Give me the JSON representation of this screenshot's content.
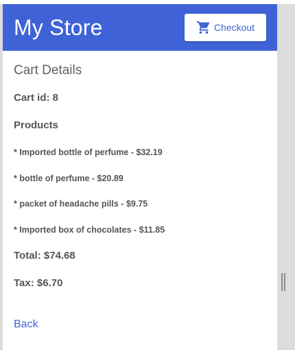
{
  "header": {
    "title": "My Store",
    "checkout_label": "Checkout",
    "checkout_icon": "shopping-cart-icon"
  },
  "cart": {
    "section_title": "Cart Details",
    "id_text": "Cart id: 8",
    "products_heading": "Products",
    "products": [
      "* Imported bottle of perfume - $32.19",
      "* bottle of perfume - $20.89",
      "* packet of headache pills - $9.75",
      "* Imported box of chocolates - $11.85"
    ],
    "total_text": "Total: $74.68",
    "tax_text": "Tax: $6.70"
  },
  "nav": {
    "back_label": "Back"
  },
  "colors": {
    "primary": "#3f63d7",
    "text": "#555555",
    "heading": "#616161",
    "backdrop": "#dcdcdc"
  }
}
